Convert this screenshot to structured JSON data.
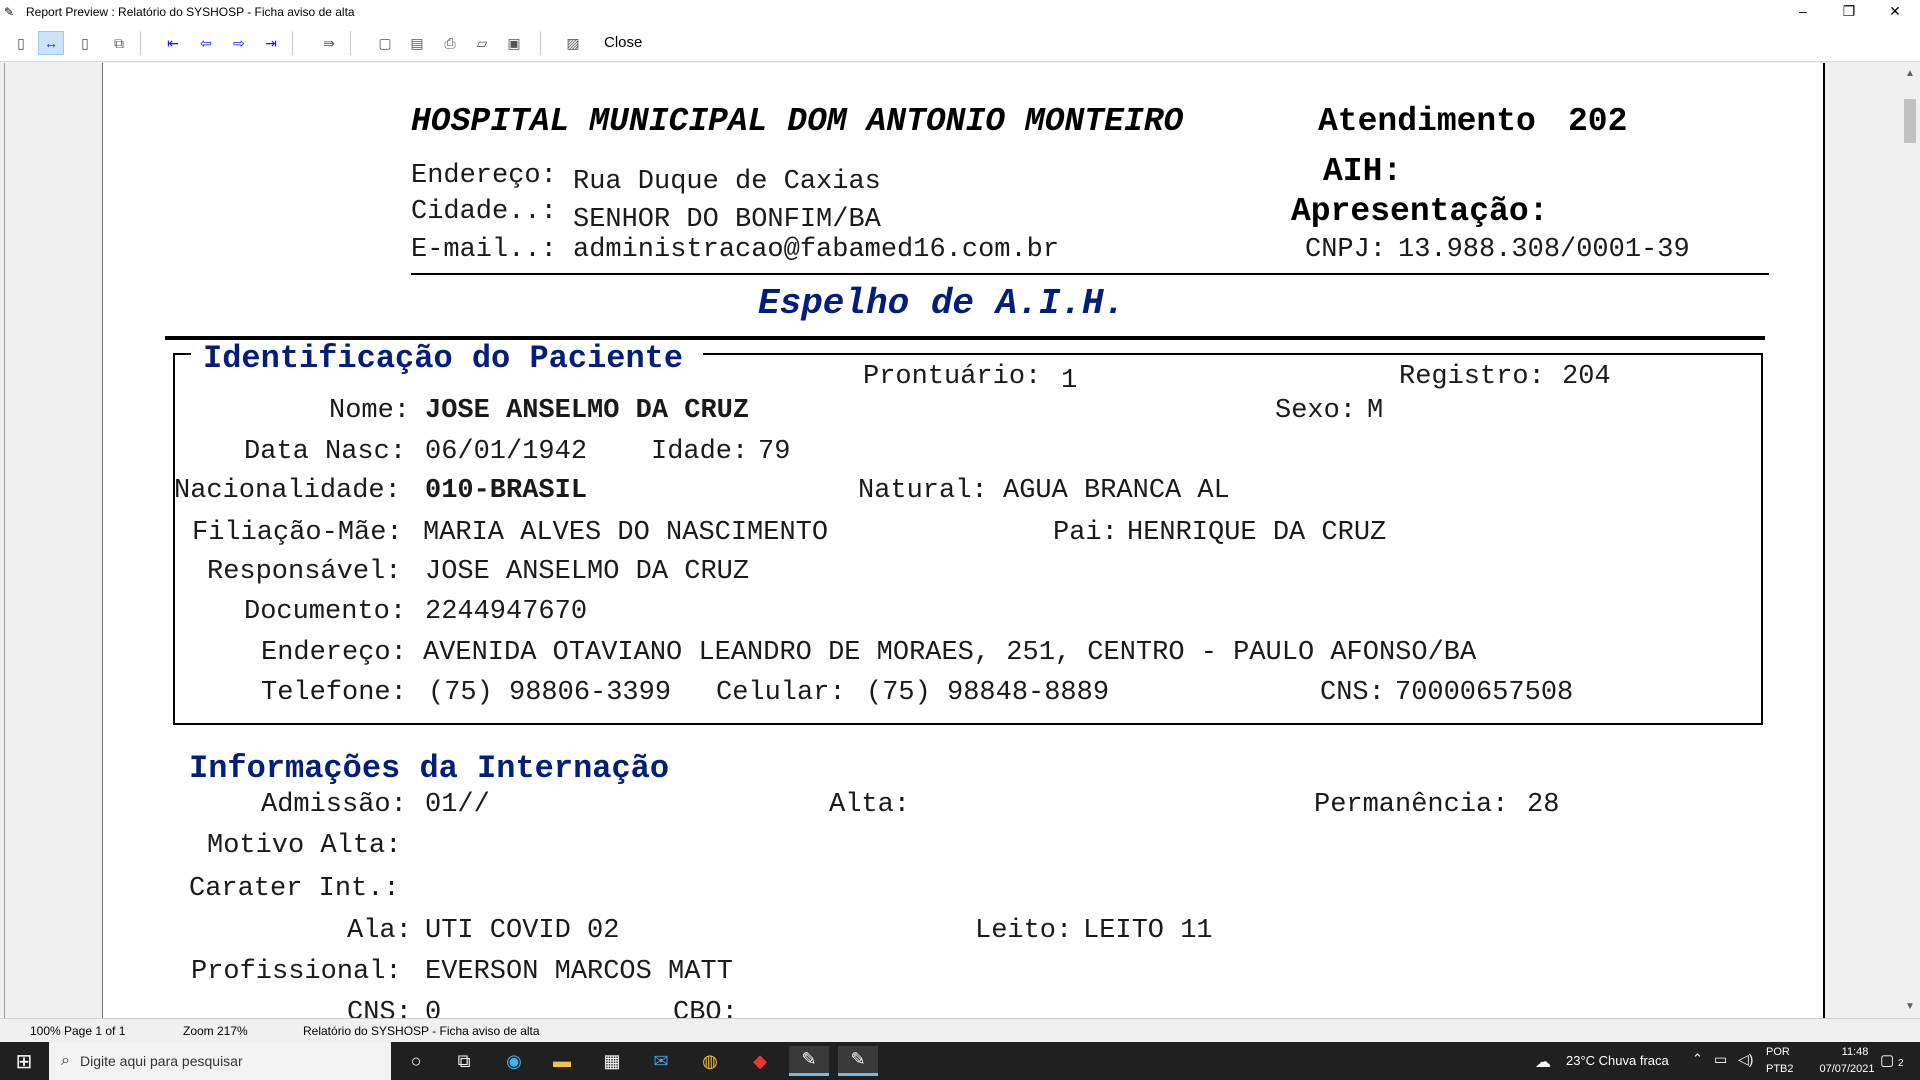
{
  "window": {
    "title": "Report Preview : Relatório do SYSHOSP - Ficha aviso de alta",
    "minimize": "–",
    "restore": "❐",
    "close": "✕"
  },
  "toolbar": {
    "close_label": "Close"
  },
  "report": {
    "hospital_name": "HOSPITAL MUNICIPAL DOM ANTONIO MONTEIRO",
    "atendimento_label": "Atendimento",
    "atendimento_value": "202",
    "endereco_label": "Endereço:",
    "endereco_value": "Rua Duque de Caxias",
    "cidade_label": "Cidade..:",
    "cidade_value": "SENHOR DO BONFIM/BA",
    "email_label": "E-mail..:",
    "email_value": "administracao@fabamed16.com.br",
    "aih_label": "AIH:",
    "apresentacao_label": "Apresentação:",
    "cnpj_label": "CNPJ:",
    "cnpj_value": "13.988.308/0001-39",
    "doc_title": "Espelho de A.I.H.",
    "paciente": {
      "section_title": "Identificação do Paciente",
      "prontuario_label": "Prontuário:",
      "prontuario_value": "1",
      "registro_label": "Registro:",
      "registro_value": "204",
      "nome_label": "Nome:",
      "nome_value": "JOSE ANSELMO DA CRUZ",
      "sexo_label": "Sexo:",
      "sexo_value": "M",
      "nasc_label": "Data Nasc:",
      "nasc_value": "06/01/1942",
      "idade_label": "Idade:",
      "idade_value": "79",
      "nacionalidade_label": "Nacionalidade:",
      "nacionalidade_value": "010-BRASIL",
      "natural_label": "Natural:",
      "natural_value": "AGUA BRANCA AL",
      "mae_label": "Filiação-Mãe:",
      "mae_value": "MARIA ALVES DO NASCIMENTO",
      "pai_label": "Pai:",
      "pai_value": "HENRIQUE DA CRUZ",
      "responsavel_label": "Responsável:",
      "responsavel_value": "JOSE ANSELMO DA CRUZ",
      "documento_label": "Documento:",
      "documento_value": "2244947670",
      "endereco_label": "Endereço:",
      "endereco_value": "AVENIDA OTAVIANO LEANDRO DE MORAES, 251, CENTRO - PAULO AFONSO/BA",
      "telefone_label": "Telefone:",
      "telefone_value": "(75) 98806-3399",
      "celular_label": "Celular:",
      "celular_value": "(75) 98848-8889",
      "cns_label": "CNS:",
      "cns_value": "70000657508"
    },
    "internacao": {
      "section_title": "Informações da Internação",
      "admissao_label": "Admissão:",
      "admissao_value": "01//",
      "alta_label": "Alta:",
      "permanencia_label": "Permanência:",
      "permanencia_value": "28",
      "motivo_label": "Motivo Alta:",
      "carater_label": "Carater Int.:",
      "ala_label": "Ala:",
      "ala_value": "UTI COVID 02",
      "leito_label": "Leito:",
      "leito_value": "LEITO 11",
      "profissional_label": "Profissional:",
      "profissional_value": "EVERSON MARCOS MATT",
      "cns_label": "CNS:",
      "cns_value": "0",
      "cbo_label": "CBO:"
    }
  },
  "statusbar": {
    "zoom_pct": "100%",
    "page": "Page 1 of 1",
    "zoom": "Zoom 217%",
    "report_name": "Relatório do SYSHOSP - Ficha aviso de alta"
  },
  "taskbar": {
    "search_placeholder": "Digite aqui para pesquisar",
    "weather": "23°C  Chuva fraca",
    "lang1": "POR",
    "lang2": "PTB2",
    "time": "11:48",
    "date": "07/07/2021",
    "notif_count": "2"
  }
}
